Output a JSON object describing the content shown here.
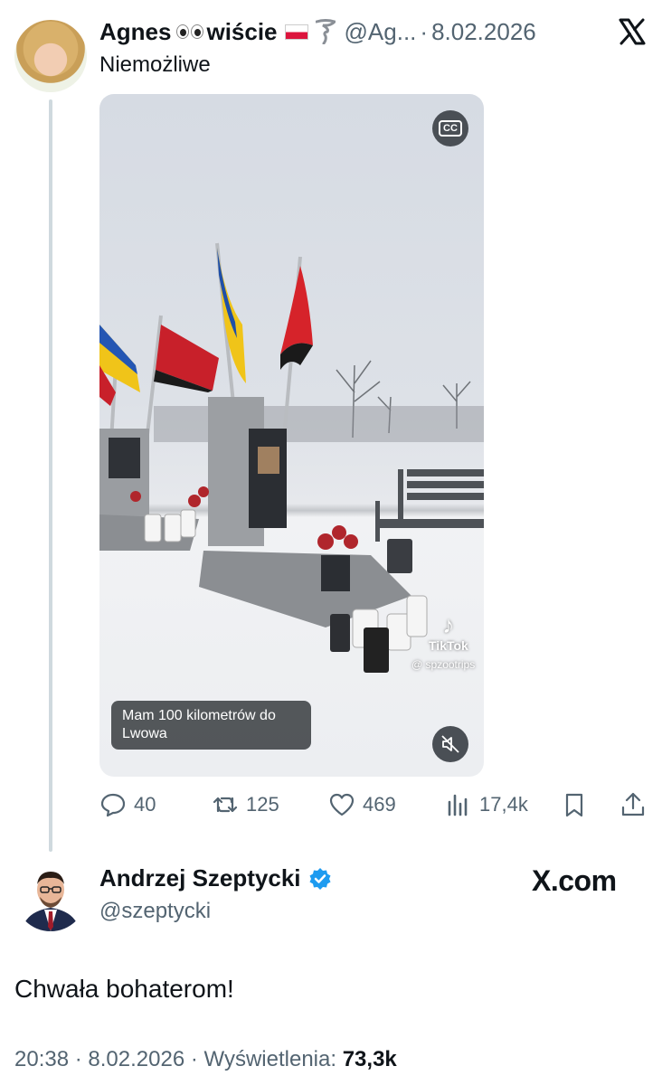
{
  "quoted_tweet": {
    "author_name": "Agnes",
    "author_name_suffix": "wiście",
    "handle": "@Ag...",
    "separator": "·",
    "date": "8.02.2026",
    "text": "Niemożliwe",
    "video": {
      "caption": "Mam 100 kilometrów do Lwowa",
      "watermark_brand": "TikTok",
      "watermark_user": "@ spzootrips",
      "cc_label": "CC"
    },
    "actions": {
      "replies": "40",
      "reposts": "125",
      "likes": "469",
      "views": "17,4k"
    }
  },
  "main_tweet": {
    "author_name": "Andrzej Szeptycki",
    "handle": "@szeptycki",
    "source_logo_text": "X.com",
    "text": "Chwała bohaterom!",
    "time": "20:38",
    "date": "8.02.2026",
    "views_label": "Wyświetlenia:",
    "views_count": "73,3k"
  },
  "colors": {
    "secondary_text": "#536471",
    "primary_text": "#0f1419",
    "verified_blue": "#1d9bf0",
    "thread_line": "#cfd9de"
  },
  "icons": [
    "x-logo-icon",
    "cc-icon",
    "mute-icon",
    "reply-icon",
    "repost-icon",
    "like-icon",
    "views-icon",
    "bookmark-icon",
    "share-icon",
    "verified-badge-icon"
  ]
}
